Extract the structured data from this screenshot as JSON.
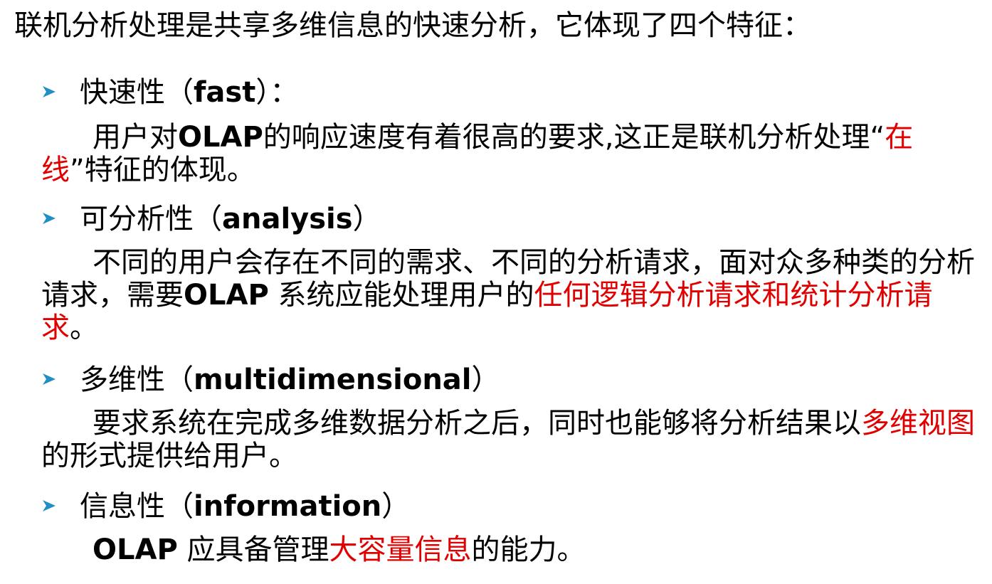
{
  "intro": "联机分析处理是共享多维信息的快速分析，它体现了四个特征：",
  "colors": {
    "text": "#000000",
    "highlight": "#e00000",
    "bullet": "#1f8fc4"
  },
  "bullet_icon": "triangle-arrow-icon",
  "items": [
    {
      "title_zh": "快速性（",
      "title_en": "fast",
      "title_end": "）：",
      "body": [
        {
          "t": "用户对"
        },
        {
          "t": "OLAP",
          "b": true
        },
        {
          "t": "的响应速度有着很高的要求,这正是联机分析处理“"
        },
        {
          "t": "在线",
          "r": true
        },
        {
          "t": "”特征的体现。"
        }
      ]
    },
    {
      "title_zh": "可分析性（",
      "title_en": "analysis",
      "title_end": "）",
      "body": [
        {
          "t": "不同的用户会存在不同的需求、不同的分析请求，面对众多种类的分析请求，需要"
        },
        {
          "t": "OLAP",
          "b": true
        },
        {
          "t": " 系统应能处理用户的"
        },
        {
          "t": "任何逻辑分析请求和统计分析请求",
          "r": true
        },
        {
          "t": "。"
        }
      ]
    },
    {
      "title_zh": "多维性（",
      "title_en": "multidimensional",
      "title_end": "）",
      "body": [
        {
          "t": "要求系统在完成多维数据分析之后，同时也能够将分析结果以"
        },
        {
          "t": "多维视图",
          "r": true
        },
        {
          "t": "的形式提供给用户。"
        }
      ]
    },
    {
      "title_zh": "信息性（",
      "title_en": "information",
      "title_end": "）",
      "body": [
        {
          "t": "OLAP",
          "b": true
        },
        {
          "t": " 应具备管理"
        },
        {
          "t": "大容量信息",
          "r": true
        },
        {
          "t": "的能力。"
        }
      ]
    }
  ]
}
